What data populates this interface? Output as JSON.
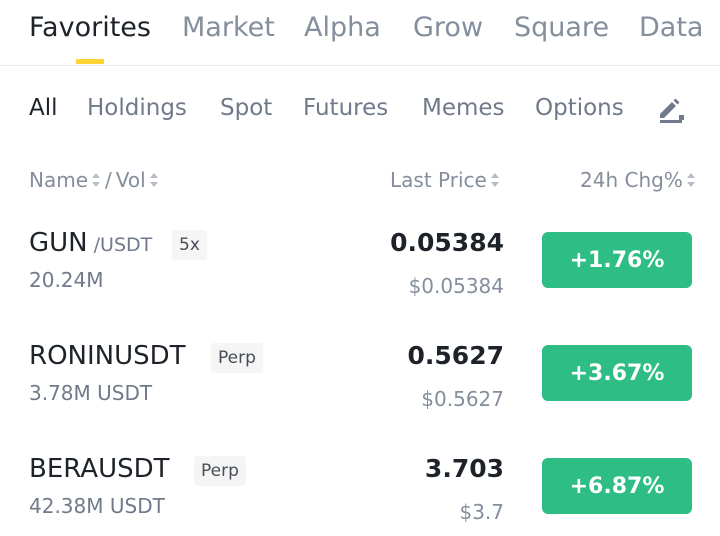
{
  "top_tabs": {
    "favorites": "Favorites",
    "market": "Market",
    "alpha": "Alpha",
    "grow": "Grow",
    "square": "Square",
    "data": "Data",
    "active": "Favorites"
  },
  "sub_tabs": {
    "all": "All",
    "holdings": "Holdings",
    "spot": "Spot",
    "futures": "Futures",
    "memes": "Memes",
    "options": "Options",
    "active": "All",
    "edit_icon": "edit-icon"
  },
  "columns": {
    "name": "Name",
    "separator": "/",
    "vol": "Vol",
    "last_price": "Last Price",
    "change": "24h Chg%"
  },
  "rows": [
    {
      "symbol": "GUN",
      "quote": "/USDT",
      "tag": "5x",
      "volume": "20.24M",
      "price": "0.05384",
      "fiat": "$0.05384",
      "change": "+1.76%"
    },
    {
      "symbol": "RONINUSDT",
      "quote": "",
      "tag": "Perp",
      "volume": "3.78M USDT",
      "price": "0.5627",
      "fiat": "$0.5627",
      "change": "+3.67%"
    },
    {
      "symbol": "BERAUSDT",
      "quote": "",
      "tag": "Perp",
      "volume": "42.38M USDT",
      "price": "3.703",
      "fiat": "$3.7",
      "change": "+6.87%"
    }
  ],
  "colors": {
    "accent": "#fcd535",
    "up": "#2ebd85",
    "text_primary": "#1e2329",
    "text_secondary": "#848e9c"
  }
}
